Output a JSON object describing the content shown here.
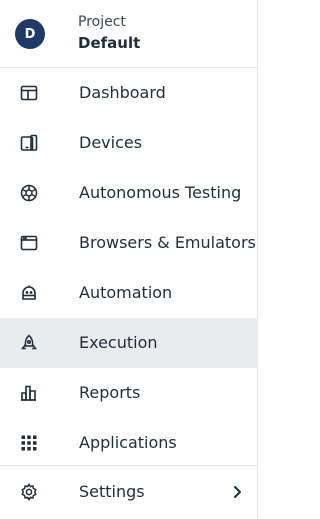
{
  "project": {
    "avatar_initial": "D",
    "label": "Project",
    "name": "Default"
  },
  "nav": {
    "items": [
      {
        "label": "Dashboard",
        "icon": "dashboard-icon"
      },
      {
        "label": "Devices",
        "icon": "devices-icon"
      },
      {
        "label": "Autonomous Testing",
        "icon": "autonomous-testing-icon"
      },
      {
        "label": "Browsers & Emulators",
        "icon": "browser-icon"
      },
      {
        "label": "Automation",
        "icon": "robot-icon"
      },
      {
        "label": "Execution",
        "icon": "rocket-icon",
        "active": true
      },
      {
        "label": "Reports",
        "icon": "reports-icon"
      },
      {
        "label": "Applications",
        "icon": "apps-grid-icon"
      }
    ],
    "settings": {
      "label": "Settings",
      "icon": "gear-icon",
      "expand_icon": "chevron-right-icon"
    }
  },
  "colors": {
    "avatar_bg": "#1f3a66",
    "active_bg": "#e9ebee",
    "text": "#1f2d3d",
    "border": "#e3e6ea"
  }
}
